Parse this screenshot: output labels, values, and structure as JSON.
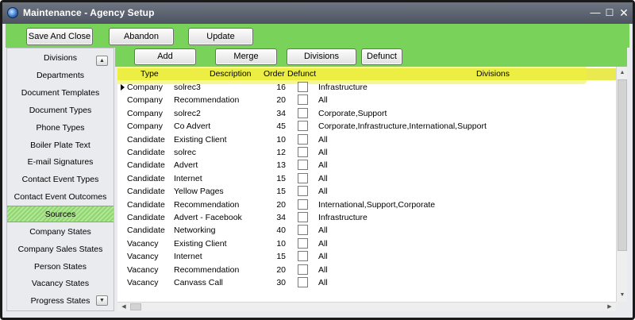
{
  "window": {
    "title": "Maintenance - Agency Setup",
    "minimize_glyph": "—",
    "maximize_glyph": "☐",
    "close_glyph": "✕"
  },
  "toolbar": {
    "save_label": "Save And Close",
    "abandon_label": "Abandon",
    "update_label": "Update"
  },
  "grid_toolbar": {
    "add_label": "Add",
    "merge_label": "Merge",
    "divisions_label": "Divisions",
    "defunct_label": "Defunct"
  },
  "sidebar": {
    "items": [
      {
        "label": "Divisions"
      },
      {
        "label": "Departments"
      },
      {
        "label": "Document Templates"
      },
      {
        "label": "Document Types"
      },
      {
        "label": "Phone Types"
      },
      {
        "label": "Boiler Plate Text"
      },
      {
        "label": "E-mail Signatures"
      },
      {
        "label": "Contact Event Types"
      },
      {
        "label": "Contact Event Outcomes"
      },
      {
        "label": "Sources",
        "selected": true
      },
      {
        "label": "Company States"
      },
      {
        "label": "Company Sales States"
      },
      {
        "label": "Person States"
      },
      {
        "label": "Vacancy States"
      },
      {
        "label": "Progress States"
      }
    ],
    "up_icon": "scroll-up-icon",
    "down_icon": "scroll-down-icon"
  },
  "grid": {
    "columns": {
      "type": "Type",
      "description": "Description",
      "order": "Order",
      "defunct": "Defunct",
      "divisions": "Divisions"
    },
    "rows": [
      {
        "type": "Company",
        "description": "solrec3",
        "order": "16",
        "defunct": false,
        "divisions": "Infrastructure",
        "current": true
      },
      {
        "type": "Company",
        "description": "Recommendation",
        "order": "20",
        "defunct": false,
        "divisions": "All"
      },
      {
        "type": "Company",
        "description": "solrec2",
        "order": "34",
        "defunct": false,
        "divisions": "Corporate,Support"
      },
      {
        "type": "Company",
        "description": "Co Advert",
        "order": "45",
        "defunct": false,
        "divisions": "Corporate,Infrastructure,International,Support"
      },
      {
        "type": "Candidate",
        "description": "Existing Client",
        "order": "10",
        "defunct": false,
        "divisions": "All"
      },
      {
        "type": "Candidate",
        "description": "solrec",
        "order": "12",
        "defunct": false,
        "divisions": "All"
      },
      {
        "type": "Candidate",
        "description": "Advert",
        "order": "13",
        "defunct": false,
        "divisions": "All"
      },
      {
        "type": "Candidate",
        "description": "Internet",
        "order": "15",
        "defunct": false,
        "divisions": "All"
      },
      {
        "type": "Candidate",
        "description": "Yellow Pages",
        "order": "15",
        "defunct": false,
        "divisions": "All"
      },
      {
        "type": "Candidate",
        "description": "Recommendation",
        "order": "20",
        "defunct": false,
        "divisions": "International,Support,Corporate"
      },
      {
        "type": "Candidate",
        "description": "Advert - Facebook",
        "order": "34",
        "defunct": false,
        "divisions": "Infrastructure"
      },
      {
        "type": "Candidate",
        "description": "Networking",
        "order": "40",
        "defunct": false,
        "divisions": "All"
      },
      {
        "type": "Vacancy",
        "description": "Existing Client",
        "order": "10",
        "defunct": false,
        "divisions": "All"
      },
      {
        "type": "Vacancy",
        "description": "Internet",
        "order": "15",
        "defunct": false,
        "divisions": "All"
      },
      {
        "type": "Vacancy",
        "description": "Recommendation",
        "order": "20",
        "defunct": false,
        "divisions": "All"
      },
      {
        "type": "Vacancy",
        "description": "Canvass Call",
        "order": "30",
        "defunct": false,
        "divisions": "All"
      }
    ]
  },
  "colors": {
    "toolbar_green": "#79d35a",
    "header_yellow": "#e8ea4f",
    "selected_green": "#8fd66f"
  }
}
